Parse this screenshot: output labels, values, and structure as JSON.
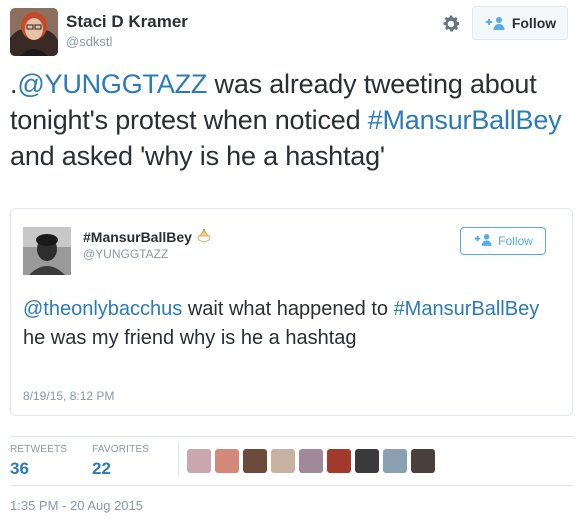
{
  "author": {
    "name": "Staci D Kramer",
    "handle": "@sdkstl",
    "follow_label": "Follow"
  },
  "tweet": {
    "segments": [
      {
        "text": ".",
        "link": false
      },
      {
        "text": "@YUNGGTAZZ",
        "link": true
      },
      {
        "text": " was already tweeting about tonight's protest when noticed ",
        "link": false
      },
      {
        "text": "#MansurBallBey",
        "link": true
      },
      {
        "text": " and asked 'why is he a hashtag'",
        "link": false
      }
    ],
    "timestamp": "1:35 PM - 20 Aug 2015"
  },
  "quoted": {
    "name": "#MansurBallBey",
    "handle": "@YUNGGTAZZ",
    "follow_label": "Follow",
    "segments": [
      {
        "text": "@theonlybacchus",
        "link": true
      },
      {
        "text": " wait what happened to ",
        "link": false
      },
      {
        "text": "#MansurBallBey",
        "link": true
      },
      {
        "text": " he was my friend why is he a hashtag",
        "link": false
      }
    ],
    "timestamp": "8/19/15, 8:12 PM"
  },
  "stats": {
    "retweets_label": "RETWEETS",
    "retweets": "36",
    "favorites_label": "FAVORITES",
    "favorites": "22"
  },
  "favoriters": [
    {
      "name": "favoriter-1",
      "color": "#c9a6b0"
    },
    {
      "name": "favoriter-2",
      "color": "#d38a7a"
    },
    {
      "name": "favoriter-3",
      "color": "#6b4a3a"
    },
    {
      "name": "favoriter-4",
      "color": "#c8b2a2"
    },
    {
      "name": "favoriter-5",
      "color": "#a08a9a"
    },
    {
      "name": "favoriter-6",
      "color": "#a13a2a"
    },
    {
      "name": "favoriter-7",
      "color": "#3a3a3a"
    },
    {
      "name": "favoriter-8",
      "color": "#8aa0b0"
    },
    {
      "name": "favoriter-9",
      "color": "#4a3f3a"
    }
  ],
  "colors": {
    "link": "#2b7bb9",
    "accent": "#55acee",
    "muted": "#8899a6",
    "text": "#292f33",
    "border": "#e1e8ed"
  },
  "icons": [
    "gear-icon",
    "add-user-icon",
    "party-hat-icon"
  ]
}
